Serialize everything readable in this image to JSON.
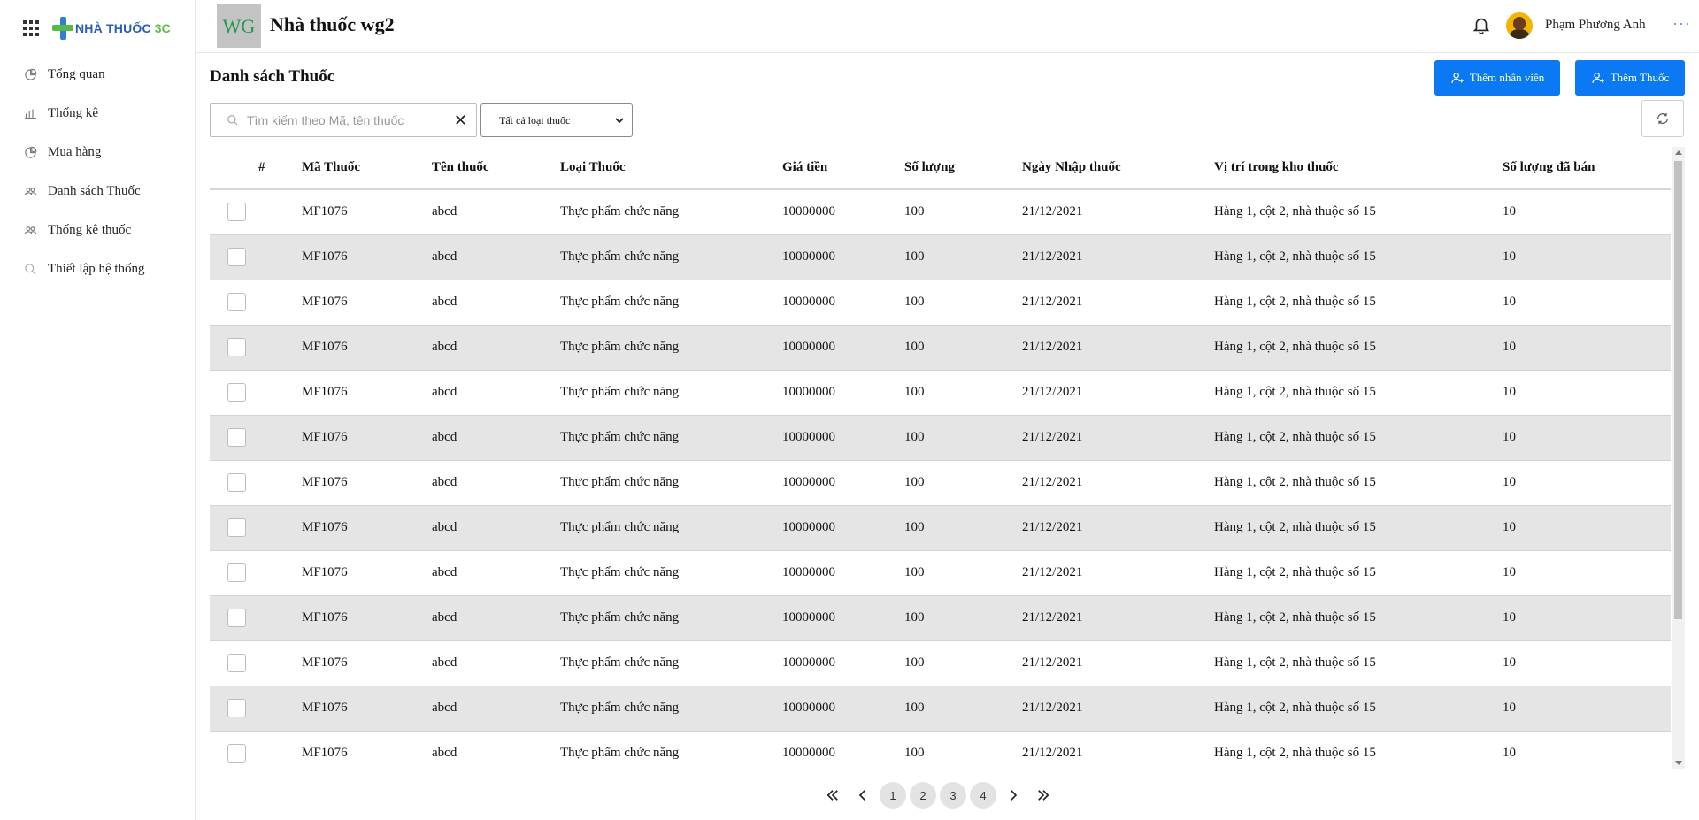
{
  "brand": {
    "logo_text": "NHÀ THUỐC",
    "logo_suffix": "3C"
  },
  "sidebar": {
    "items": [
      {
        "label": "Tổng quan",
        "icon": "pie-chart-icon"
      },
      {
        "label": "Thống kê",
        "icon": "bar-chart-icon"
      },
      {
        "label": "Mua hàng",
        "icon": "pie-chart-icon"
      },
      {
        "label": "Danh sách Thuốc",
        "icon": "users-icon"
      },
      {
        "label": "Thống kê thuốc",
        "icon": "users-icon"
      },
      {
        "label": "Thiết lập hệ thống",
        "icon": "search-icon"
      }
    ]
  },
  "header": {
    "badge": "WG",
    "store_name": "Nhà thuốc wg2",
    "user_name": "Phạm Phương Anh",
    "more": "···"
  },
  "page": {
    "title": "Danh sách Thuốc",
    "add_staff_label": "Thêm nhân viên",
    "add_drug_label": "Thêm Thuốc",
    "search_placeholder": "Tìm kiếm theo Mã, tên thuốc",
    "clear_symbol": "✕",
    "filter_selected": "Tất cả loại thuốc"
  },
  "table": {
    "columns": [
      "#",
      "Mã Thuốc",
      "Tên thuốc",
      "Loại Thuốc",
      "Giá tiền",
      "Số lượng",
      "Ngày Nhập thuốc",
      "Vị trí trong kho thuốc",
      "Số lượng đã bán"
    ],
    "rows": [
      [
        "MF1076",
        "abcd",
        "Thực phẩm chức năng",
        "10000000",
        "100",
        "21/12/2021",
        "Hàng 1, cột 2, nhà thuộc số 15",
        "10"
      ],
      [
        "MF1076",
        "abcd",
        "Thực phẩm chức năng",
        "10000000",
        "100",
        "21/12/2021",
        "Hàng 1, cột 2, nhà thuộc số 15",
        "10"
      ],
      [
        "MF1076",
        "abcd",
        "Thực phẩm chức năng",
        "10000000",
        "100",
        "21/12/2021",
        "Hàng 1, cột 2, nhà thuộc số 15",
        "10"
      ],
      [
        "MF1076",
        "abcd",
        "Thực phẩm chức năng",
        "10000000",
        "100",
        "21/12/2021",
        "Hàng 1, cột 2, nhà thuộc số 15",
        "10"
      ],
      [
        "MF1076",
        "abcd",
        "Thực phẩm chức năng",
        "10000000",
        "100",
        "21/12/2021",
        "Hàng 1, cột 2, nhà thuộc số 15",
        "10"
      ],
      [
        "MF1076",
        "abcd",
        "Thực phẩm chức năng",
        "10000000",
        "100",
        "21/12/2021",
        "Hàng 1, cột 2, nhà thuộc số 15",
        "10"
      ],
      [
        "MF1076",
        "abcd",
        "Thực phẩm chức năng",
        "10000000",
        "100",
        "21/12/2021",
        "Hàng 1, cột 2, nhà thuộc số 15",
        "10"
      ],
      [
        "MF1076",
        "abcd",
        "Thực phẩm chức năng",
        "10000000",
        "100",
        "21/12/2021",
        "Hàng 1, cột 2, nhà thuộc số 15",
        "10"
      ],
      [
        "MF1076",
        "abcd",
        "Thực phẩm chức năng",
        "10000000",
        "100",
        "21/12/2021",
        "Hàng 1, cột 2, nhà thuộc số 15",
        "10"
      ],
      [
        "MF1076",
        "abcd",
        "Thực phẩm chức năng",
        "10000000",
        "100",
        "21/12/2021",
        "Hàng 1, cột 2, nhà thuộc số 15",
        "10"
      ],
      [
        "MF1076",
        "abcd",
        "Thực phẩm chức năng",
        "10000000",
        "100",
        "21/12/2021",
        "Hàng 1, cột 2, nhà thuộc số 15",
        "10"
      ],
      [
        "MF1076",
        "abcd",
        "Thực phẩm chức năng",
        "10000000",
        "100",
        "21/12/2021",
        "Hàng 1, cột 2, nhà thuộc số 15",
        "10"
      ],
      [
        "MF1076",
        "abcd",
        "Thực phẩm chức năng",
        "10000000",
        "100",
        "21/12/2021",
        "Hàng 1, cột 2, nhà thuộc số 15",
        "10"
      ]
    ]
  },
  "pagination": {
    "pages": [
      "1",
      "2",
      "3",
      "4"
    ]
  },
  "colors": {
    "primary": "#0a79f3",
    "logo_blue": "#2a5fb5",
    "logo_green": "#5cbf44",
    "badge_bg": "#c3c3c3",
    "badge_text": "#1f9a4a",
    "row_alt": "#e5e5e5"
  }
}
